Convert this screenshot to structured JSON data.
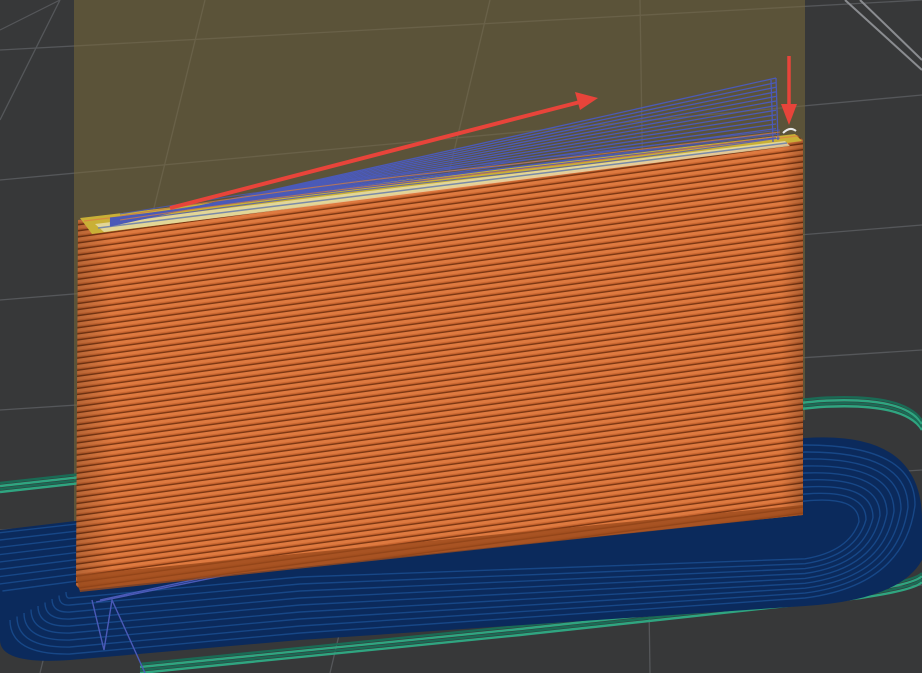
{
  "viewport": {
    "background_color": "#3a3b3c"
  },
  "colors": {
    "grid_line": "#55575a",
    "grid_line_bright": "#8a8c90",
    "bed_shade": "#333435",
    "print_volume_overlay": "#7a6a3a",
    "object_layer_light": "#d8703a",
    "object_layer_dark": "#7c3a14",
    "object_top_yellow": "#c9b036",
    "object_top_inner": "#e8e0b0",
    "brim_navy": "#0b2a5c",
    "brim_navy_line": "#184a8c",
    "skirt_green": "#1a6b55",
    "skirt_green_line": "#2fa580",
    "travel_move": "#4b5ab8",
    "annotation_arrow": "#e8443a"
  },
  "icons": {
    "annotation_arrow_diagonal": "arrow-up-right-icon",
    "annotation_arrow_down": "arrow-down-icon"
  }
}
